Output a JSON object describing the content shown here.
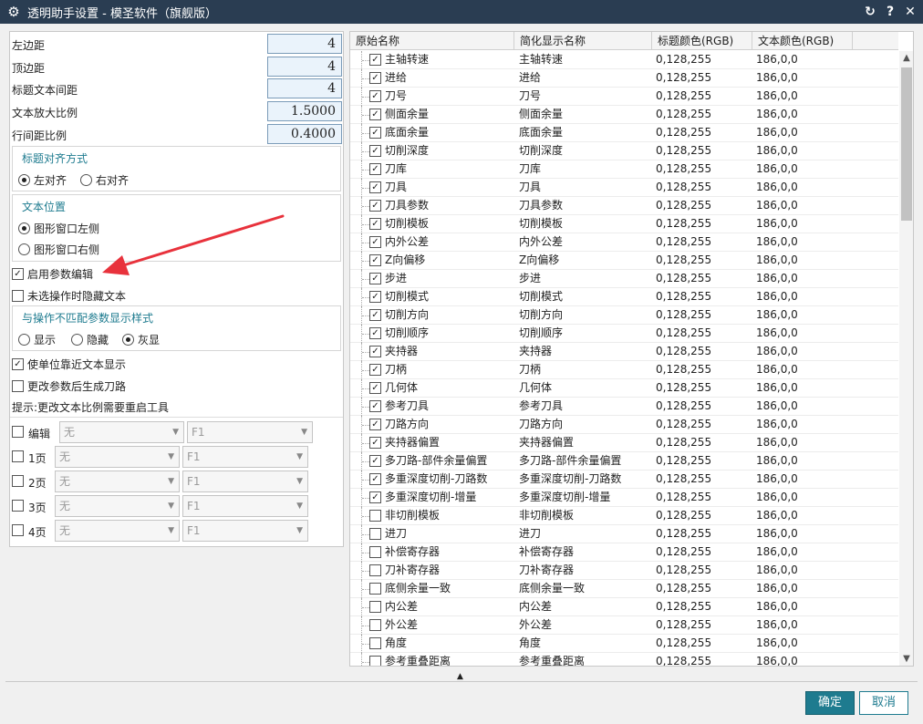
{
  "window": {
    "title": "透明助手设置 - 模圣软件（旗舰版）"
  },
  "left": {
    "fields": [
      {
        "label": "左边距",
        "value": "4"
      },
      {
        "label": "顶边距",
        "value": "4"
      },
      {
        "label": "标题文本间距",
        "value": "4"
      },
      {
        "label": "文本放大比例",
        "value": "1.5000"
      },
      {
        "label": "行间距比例",
        "value": "0.4000"
      }
    ],
    "title_align": {
      "title": "标题对齐方式",
      "left": "左对齐",
      "right": "右对齐",
      "selected": "left"
    },
    "text_pos": {
      "title": "文本位置",
      "opt1": "图形窗口左侧",
      "opt2": "图形窗口右侧",
      "selected": "opt1"
    },
    "enable_param_edit": {
      "label": "启用参数编辑",
      "checked": true
    },
    "hide_unselected": {
      "label": "未选操作时隐藏文本",
      "checked": false
    },
    "mismatch_style": {
      "title": "与操作不匹配参数显示样式",
      "show": "显示",
      "hide": "隐藏",
      "gray": "灰显",
      "selected": "gray"
    },
    "unit_near_text": {
      "label": "使单位靠近文本显示",
      "checked": true
    },
    "gen_toolpath": {
      "label": "更改参数后生成刀路",
      "checked": false
    },
    "hint": "提示:更改文本比例需要重启工具",
    "pages": [
      {
        "label": "编辑",
        "combo1": "无",
        "combo2": "F1"
      },
      {
        "label": "1页",
        "combo1": "无",
        "combo2": "F1"
      },
      {
        "label": "2页",
        "combo1": "无",
        "combo2": "F1"
      },
      {
        "label": "3页",
        "combo1": "无",
        "combo2": "F1"
      },
      {
        "label": "4页",
        "combo1": "无",
        "combo2": "F1"
      }
    ]
  },
  "table": {
    "headers": [
      "原始名称",
      "简化显示名称",
      "标题颜色(RGB)",
      "文本颜色(RGB)"
    ],
    "rows": [
      {
        "name": "主轴转速",
        "short": "主轴转速",
        "title_rgb": "0,128,255",
        "text_rgb": "186,0,0",
        "checked": true
      },
      {
        "name": "进给",
        "short": "进给",
        "title_rgb": "0,128,255",
        "text_rgb": "186,0,0",
        "checked": true
      },
      {
        "name": "刀号",
        "short": "刀号",
        "title_rgb": "0,128,255",
        "text_rgb": "186,0,0",
        "checked": true
      },
      {
        "name": "侧面余量",
        "short": "侧面余量",
        "title_rgb": "0,128,255",
        "text_rgb": "186,0,0",
        "checked": true
      },
      {
        "name": "底面余量",
        "short": "底面余量",
        "title_rgb": "0,128,255",
        "text_rgb": "186,0,0",
        "checked": true
      },
      {
        "name": "切削深度",
        "short": "切削深度",
        "title_rgb": "0,128,255",
        "text_rgb": "186,0,0",
        "checked": true
      },
      {
        "name": "刀库",
        "short": "刀库",
        "title_rgb": "0,128,255",
        "text_rgb": "186,0,0",
        "checked": true
      },
      {
        "name": "刀具",
        "short": "刀具",
        "title_rgb": "0,128,255",
        "text_rgb": "186,0,0",
        "checked": true
      },
      {
        "name": "刀具参数",
        "short": "刀具参数",
        "title_rgb": "0,128,255",
        "text_rgb": "186,0,0",
        "checked": true
      },
      {
        "name": "切削模板",
        "short": "切削模板",
        "title_rgb": "0,128,255",
        "text_rgb": "186,0,0",
        "checked": true
      },
      {
        "name": "内外公差",
        "short": "内外公差",
        "title_rgb": "0,128,255",
        "text_rgb": "186,0,0",
        "checked": true
      },
      {
        "name": "Z向偏移",
        "short": "Z向偏移",
        "title_rgb": "0,128,255",
        "text_rgb": "186,0,0",
        "checked": true
      },
      {
        "name": "步进",
        "short": "步进",
        "title_rgb": "0,128,255",
        "text_rgb": "186,0,0",
        "checked": true
      },
      {
        "name": "切削模式",
        "short": "切削模式",
        "title_rgb": "0,128,255",
        "text_rgb": "186,0,0",
        "checked": true
      },
      {
        "name": "切削方向",
        "short": "切削方向",
        "title_rgb": "0,128,255",
        "text_rgb": "186,0,0",
        "checked": true
      },
      {
        "name": "切削顺序",
        "short": "切削顺序",
        "title_rgb": "0,128,255",
        "text_rgb": "186,0,0",
        "checked": true
      },
      {
        "name": "夹持器",
        "short": "夹持器",
        "title_rgb": "0,128,255",
        "text_rgb": "186,0,0",
        "checked": true
      },
      {
        "name": "刀柄",
        "short": "刀柄",
        "title_rgb": "0,128,255",
        "text_rgb": "186,0,0",
        "checked": true
      },
      {
        "name": "几何体",
        "short": "几何体",
        "title_rgb": "0,128,255",
        "text_rgb": "186,0,0",
        "checked": true
      },
      {
        "name": "参考刀具",
        "short": "参考刀具",
        "title_rgb": "0,128,255",
        "text_rgb": "186,0,0",
        "checked": true
      },
      {
        "name": "刀路方向",
        "short": "刀路方向",
        "title_rgb": "0,128,255",
        "text_rgb": "186,0,0",
        "checked": true
      },
      {
        "name": "夹持器偏置",
        "short": "夹持器偏置",
        "title_rgb": "0,128,255",
        "text_rgb": "186,0,0",
        "checked": true
      },
      {
        "name": "多刀路-部件余量偏置",
        "short": "多刀路-部件余量偏置",
        "title_rgb": "0,128,255",
        "text_rgb": "186,0,0",
        "checked": true
      },
      {
        "name": "多重深度切削-刀路数",
        "short": "多重深度切削-刀路数",
        "title_rgb": "0,128,255",
        "text_rgb": "186,0,0",
        "checked": true
      },
      {
        "name": "多重深度切削-增量",
        "short": "多重深度切削-增量",
        "title_rgb": "0,128,255",
        "text_rgb": "186,0,0",
        "checked": true
      },
      {
        "name": "非切削模板",
        "short": "非切削模板",
        "title_rgb": "0,128,255",
        "text_rgb": "186,0,0",
        "checked": false
      },
      {
        "name": "进刀",
        "short": "进刀",
        "title_rgb": "0,128,255",
        "text_rgb": "186,0,0",
        "checked": false
      },
      {
        "name": "补偿寄存器",
        "short": "补偿寄存器",
        "title_rgb": "0,128,255",
        "text_rgb": "186,0,0",
        "checked": false
      },
      {
        "name": "刀补寄存器",
        "short": "刀补寄存器",
        "title_rgb": "0,128,255",
        "text_rgb": "186,0,0",
        "checked": false
      },
      {
        "name": "底侧余量一致",
        "short": "底侧余量一致",
        "title_rgb": "0,128,255",
        "text_rgb": "186,0,0",
        "checked": false
      },
      {
        "name": "内公差",
        "short": "内公差",
        "title_rgb": "0,128,255",
        "text_rgb": "186,0,0",
        "checked": false
      },
      {
        "name": "外公差",
        "short": "外公差",
        "title_rgb": "0,128,255",
        "text_rgb": "186,0,0",
        "checked": false
      },
      {
        "name": "角度",
        "short": "角度",
        "title_rgb": "0,128,255",
        "text_rgb": "186,0,0",
        "checked": false
      },
      {
        "name": "参考重叠距离",
        "short": "参考重叠距离",
        "title_rgb": "0,128,255",
        "text_rgb": "186,0,0",
        "checked": false
      }
    ]
  },
  "buttons": {
    "ok": "确定",
    "cancel": "取消"
  },
  "colors": {
    "titlebar": "#2a3d52",
    "accent": "#1e7b8f",
    "annotation_arrow": "#e8323c"
  },
  "icons": {
    "window": "gear-icon",
    "refresh": "refresh-icon",
    "help": "help-icon",
    "close": "close-icon",
    "annotation": "red-arrow-annotation"
  }
}
